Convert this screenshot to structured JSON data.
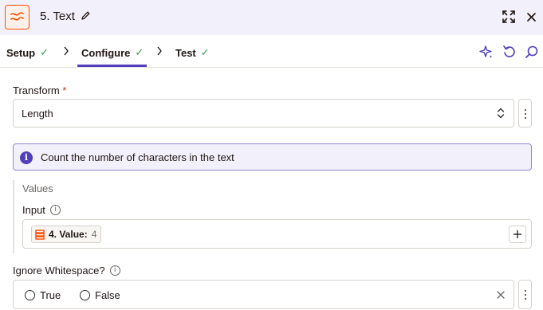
{
  "header": {
    "title": "5. Text",
    "icons": {
      "app": "formatter-icon",
      "edit": "pencil-icon",
      "expand": "expand-icon",
      "close": "close-icon"
    }
  },
  "tabs": [
    {
      "label": "Setup",
      "status": "complete"
    },
    {
      "label": "Configure",
      "status": "complete",
      "active": true
    },
    {
      "label": "Test",
      "status": "complete"
    }
  ],
  "toolbar_icons": [
    "sparkle-icon",
    "undo-icon",
    "search-icon"
  ],
  "transform": {
    "label": "Transform",
    "required_marker": "*",
    "value": "Length"
  },
  "info": {
    "text": "Count the number of characters in the text"
  },
  "values": {
    "title": "Values",
    "input_label": "Input",
    "input_token": {
      "key": "4. Value:",
      "value": "4"
    }
  },
  "ignore_whitespace": {
    "label": "Ignore Whitespace?",
    "options": [
      "True",
      "False"
    ]
  },
  "colors": {
    "accent": "#503ebd",
    "brand": "#ff4f00",
    "success": "#2e9e46",
    "header_bg": "#f2f0fa"
  }
}
